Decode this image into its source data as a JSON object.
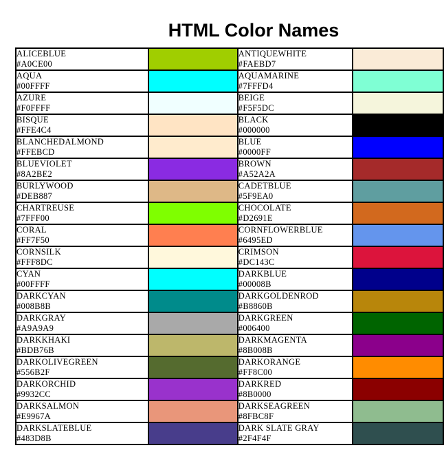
{
  "title": "HTML Color Names",
  "rows": [
    {
      "left": {
        "name": "ALICEBLUE",
        "hex": "#A0CE00",
        "swatch": "#A0CE00"
      },
      "right": {
        "name": "ANTIQUEWHITE",
        "hex": "#FAEBD7",
        "swatch": "#FAEBD7"
      }
    },
    {
      "left": {
        "name": "AQUA",
        "hex": "#00FFFF",
        "swatch": "#00FFFF"
      },
      "right": {
        "name": "AQUAMARINE",
        "hex": "#7FFFD4",
        "swatch": "#7FFFD4"
      }
    },
    {
      "left": {
        "name": "AZURE",
        "hex": "#F0FFFF",
        "swatch": "#F0FFFF"
      },
      "right": {
        "name": "BEIGE",
        "hex": "#F5F5DC",
        "swatch": "#F5F5DC"
      }
    },
    {
      "left": {
        "name": "BISQUE",
        "hex": "#FFE4C4",
        "swatch": "#FFE4C4"
      },
      "right": {
        "name": "BLACK",
        "hex": "#000000",
        "swatch": "#000000"
      }
    },
    {
      "left": {
        "name": "BLANCHEDALMOND",
        "hex": "#FFEBCD",
        "swatch": "#FFEBCD"
      },
      "right": {
        "name": "BLUE",
        "hex": "#0000FF",
        "swatch": "#0000FF"
      }
    },
    {
      "left": {
        "name": "BLUEVIOLET",
        "hex": "#8A2BE2",
        "swatch": "#8A2BE2"
      },
      "right": {
        "name": "BROWN",
        "hex": "#A52A2A",
        "swatch": "#A52A2A"
      }
    },
    {
      "left": {
        "name": "BURLYWOOD",
        "hex": "#DEB887",
        "swatch": "#DEB887"
      },
      "right": {
        "name": "CADETBLUE",
        "hex": "#5F9EA0",
        "swatch": "#5F9EA0"
      }
    },
    {
      "left": {
        "name": "CHARTREUSE",
        "hex": "#7FFF00",
        "swatch": "#7FFF00"
      },
      "right": {
        "name": "CHOCOLATE",
        "hex": "#D2691E",
        "swatch": "#D2691E"
      }
    },
    {
      "left": {
        "name": "CORAL",
        "hex": "#FF7F50",
        "swatch": "#FF7F50"
      },
      "right": {
        "name": "CORNFLOWERBLUE",
        "hex": "#6495ED",
        "swatch": "#6495ED"
      }
    },
    {
      "left": {
        "name": "CORNSILK",
        "hex": "#FFF8DC",
        "swatch": "#FFF8DC"
      },
      "right": {
        "name": "CRIMSON",
        "hex": "#DC143C",
        "swatch": "#DC143C"
      }
    },
    {
      "left": {
        "name": "CYAN",
        "hex": "#00FFFF",
        "swatch": "#00FFFF"
      },
      "right": {
        "name": "DARKBLUE",
        "hex": "#00008B",
        "swatch": "#00008B"
      }
    },
    {
      "left": {
        "name": "DARKCYAN",
        "hex": "#008B8B",
        "swatch": "#008B8B"
      },
      "right": {
        "name": "DARKGOLDENROD",
        "hex": "#B8860B",
        "swatch": "#B8860B"
      }
    },
    {
      "left": {
        "name": "DARKGRAY",
        "hex": "#A9A9A9",
        "swatch": "#A9A9A9"
      },
      "right": {
        "name": "DARKGREEN",
        "hex": "#006400",
        "swatch": "#006400"
      }
    },
    {
      "left": {
        "name": "DARKKHAKI",
        "hex": "#BDB76B",
        "swatch": "#BDB76B"
      },
      "right": {
        "name": "DARKMAGENTA",
        "hex": "#8B008B",
        "swatch": "#8B008B"
      }
    },
    {
      "left": {
        "name": "DARKOLIVEGREEN",
        "hex": "#556B2F",
        "swatch": "#556B2F"
      },
      "right": {
        "name": "DARKORANGE",
        "hex": "#FF8C00",
        "swatch": "#FF8C00"
      }
    },
    {
      "left": {
        "name": "DARKORCHID",
        "hex": "#9932CC",
        "swatch": "#9932CC"
      },
      "right": {
        "name": "DARKRED",
        "hex": "#8B0000",
        "swatch": "#8B0000"
      }
    },
    {
      "left": {
        "name": "DARKSALMON",
        "hex": "#E9967A",
        "swatch": "#E9967A"
      },
      "right": {
        "name": "DARKSEAGREEN",
        "hex": "#8FBC8F",
        "swatch": "#8FBC8F"
      }
    },
    {
      "left": {
        "name": "DARKSLATEBLUE",
        "hex": "#483D8B",
        "swatch": "#483D8B"
      },
      "right": {
        "name": "DARK SLATE GRAY",
        "hex": "#2F4F4F",
        "swatch": "#2F4F4F"
      }
    }
  ]
}
